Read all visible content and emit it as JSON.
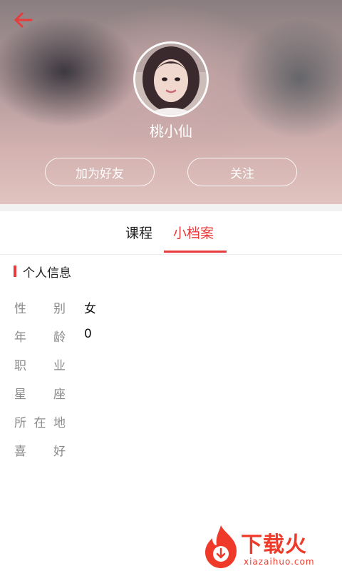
{
  "colors": {
    "accent": "#e83b3b",
    "text_primary": "#222222",
    "text_muted": "#8a8a8a",
    "divider_band": "#f2f2f2"
  },
  "header": {
    "back_icon": "arrow-left-icon",
    "avatar_icon": "user-avatar-photo",
    "name": "桃小仙",
    "add_friend_label": "加为好友",
    "follow_label": "关注"
  },
  "tabs": [
    {
      "label": "课程",
      "active": false
    },
    {
      "label": "小档案",
      "active": true
    }
  ],
  "section": {
    "title": "个人信息"
  },
  "info": [
    {
      "label": [
        "性",
        "别"
      ],
      "value": "女"
    },
    {
      "label": [
        "年",
        "龄"
      ],
      "value": "0"
    },
    {
      "label": [
        "职",
        "业"
      ],
      "value": ""
    },
    {
      "label": [
        "星",
        "座"
      ],
      "value": ""
    },
    {
      "label": [
        "所",
        "在",
        "地"
      ],
      "value": ""
    },
    {
      "label": [
        "喜",
        "好"
      ],
      "value": ""
    }
  ],
  "watermark": {
    "text": "下载火",
    "url": "xiazaihuo.com"
  }
}
